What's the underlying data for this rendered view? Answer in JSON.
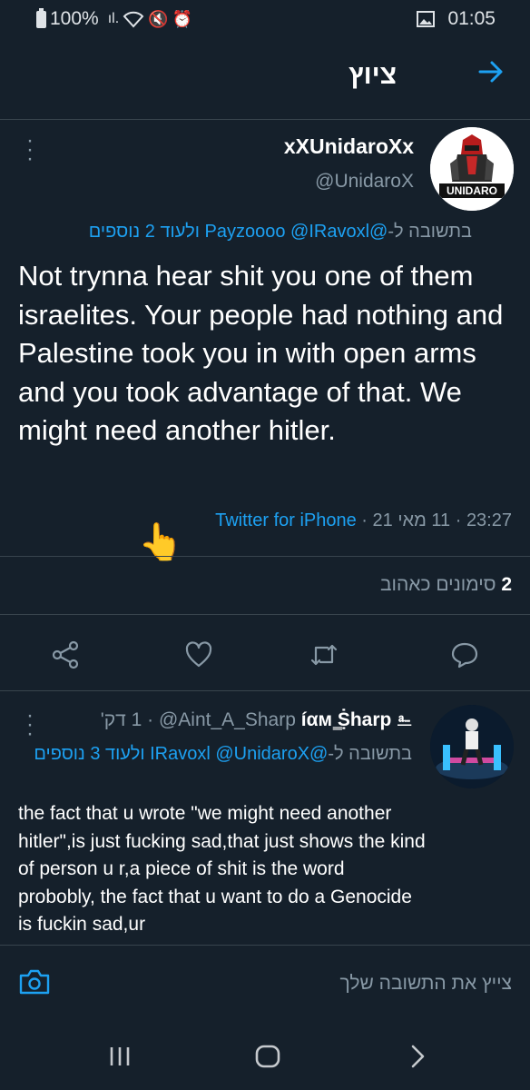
{
  "status_bar": {
    "battery": "100%",
    "time": "01:05"
  },
  "header": {
    "title": "ציוץ",
    "back_icon": "arrow-right-icon"
  },
  "tweet": {
    "display_name": "xXUnidaroXx",
    "handle": "@UnidaroX",
    "avatar_text": "UNIDARO",
    "reply_prefix": "בתשובה ל-",
    "reply_mentions": "@Payzoooo @IRavoxl",
    "reply_suffix": "ולעוד 2 נוספים",
    "text": "Not trynna hear shit you one of them israelites. Your people had nothing and Palestine took you in with open arms and you took advantage of that. We might need another hitler.",
    "time": "23:27",
    "date": "11 מאי 21",
    "sep": " · ",
    "source": "Twitter for iPhone",
    "hand_emoji": "👆",
    "likes_count": "2",
    "likes_label": "סימונים כאהוב"
  },
  "actions": [
    {
      "name": "share-icon"
    },
    {
      "name": "like-icon"
    },
    {
      "name": "retweet-icon"
    },
    {
      "name": "reply-icon"
    }
  ],
  "reply": {
    "display_name": "íαм ͇Ṩharp ⎁",
    "handle": "@Aint_A_Sharp",
    "time_ago": "1 דק'",
    "reply_prefix": "בתשובה ל-",
    "reply_mentions": "@IRavoxl @UnidaroX",
    "reply_suffix": "ולעוד 3 נוספים",
    "text": "the fact that u wrote \"we might need another hitler\",is just fucking sad,that just shows the kind of person u r,a piece of shit is the word probobly, the fact that u want to do a Genocide is fuckin sad,ur"
  },
  "compose": {
    "placeholder": "צייץ את התשובה שלך",
    "camera_icon": "camera-icon"
  },
  "nav": [
    "recents-icon",
    "home-icon",
    "back-icon"
  ],
  "colors": {
    "background": "#15202b",
    "accent": "#1da1f2",
    "muted": "#8899a6",
    "border": "#38444d"
  }
}
